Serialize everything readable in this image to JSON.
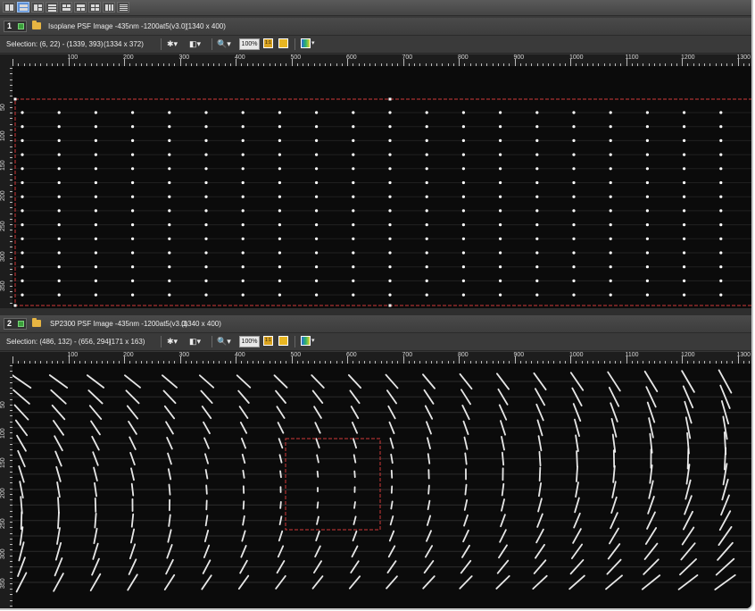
{
  "colors": {
    "accent": "#5b8fd6",
    "selection": "#d23a3a",
    "folder": "#e7b542",
    "image_bg": "#0b0b0b",
    "spot": "#ffffff"
  },
  "layout_toolbar": {
    "buttons": [
      {
        "name": "layout-two-vertical"
      },
      {
        "name": "layout-two-horizontal"
      },
      {
        "name": "layout-grid-a"
      },
      {
        "name": "layout-grid-b"
      },
      {
        "name": "layout-grid-c"
      },
      {
        "name": "layout-grid-d"
      },
      {
        "name": "layout-grid-e"
      },
      {
        "name": "layout-grid-f"
      },
      {
        "name": "layout-grid-g"
      }
    ],
    "active_index": 1
  },
  "panels": [
    {
      "number": "1",
      "title": "Isoplane PSF Image -435nm -1200at5(v3.0)",
      "dimensions": "(1340 x 400)",
      "selection": "Selection: (6, 22) - (1339, 393)",
      "selection_size": "(1334 x 372)",
      "zoom": "100%",
      "fit_label": "1:1",
      "ruler_x": [
        "100",
        "200",
        "300",
        "400",
        "500",
        "600",
        "700",
        "800",
        "900",
        "1000",
        "1100",
        "1200",
        "1300"
      ],
      "ruler_y": [
        "50",
        "100",
        "150",
        "200",
        "250",
        "300",
        "350"
      ]
    },
    {
      "number": "2",
      "title": "SP2300 PSF Image -435nm -1200at5(v3.0)",
      "dimensions": "(1340 x 400)",
      "selection": "Selection: (486, 132) - (656, 294)",
      "selection_size": "(171 x 163)",
      "zoom": "100%",
      "fit_label": "1:1",
      "ruler_x": [
        "100",
        "200",
        "300",
        "400",
        "500",
        "600",
        "700",
        "800",
        "900",
        "1000",
        "1100",
        "1200",
        "1300"
      ],
      "ruler_y": [
        "50",
        "100",
        "150",
        "200",
        "250",
        "300",
        "350"
      ]
    }
  ],
  "toolbar_icons": [
    "brightness-icon",
    "contrast-icon",
    "zoom-icon",
    "fit-icon",
    "expand-icon",
    "palette-icon"
  ]
}
